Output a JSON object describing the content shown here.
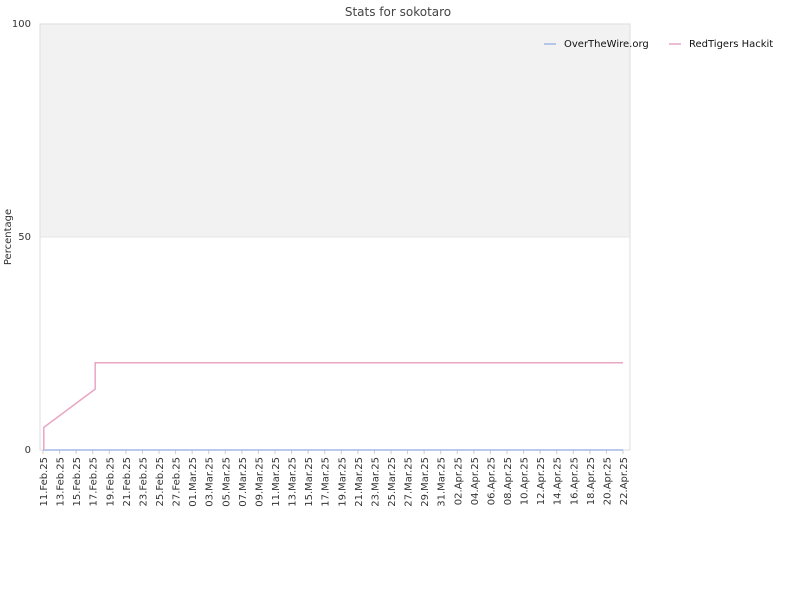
{
  "chart_data": {
    "type": "line",
    "title": "Stats for sokotaro",
    "xlabel": "",
    "ylabel": "Percentage",
    "ylim": [
      0,
      100
    ],
    "y_ticks": [
      "0",
      "50",
      "100"
    ],
    "x_ticks": [
      "11.Feb.25",
      "13.Feb.25",
      "15.Feb.25",
      "17.Feb.25",
      "19.Feb.25",
      "21.Feb.25",
      "23.Feb.25",
      "25.Feb.25",
      "27.Feb.25",
      "01.Mar.25",
      "03.Mar.25",
      "05.Mar.25",
      "07.Mar.25",
      "09.Mar.25",
      "11.Mar.25",
      "13.Mar.25",
      "15.Mar.25",
      "17.Mar.25",
      "19.Mar.25",
      "21.Mar.25",
      "23.Mar.25",
      "25.Mar.25",
      "27.Mar.25",
      "29.Mar.25",
      "31.Mar.25",
      "02.Apr.25",
      "04.Apr.25",
      "06.Apr.25",
      "08.Apr.25",
      "10.Apr.25",
      "12.Apr.25",
      "14.Apr.25",
      "16.Apr.25",
      "18.Apr.25",
      "20.Apr.25",
      "22.Apr.25"
    ],
    "grid": true,
    "legend_position": "top-right",
    "series": [
      {
        "name": "OverTheWire.org",
        "color": "#a3b8e8",
        "points": [
          [
            "11.Feb.25",
            0
          ],
          [
            "21.Apr.25",
            0
          ]
        ]
      },
      {
        "name": "RedTigers Hackit",
        "color": "#e8a6c3",
        "points": [
          [
            "11.Feb.25",
            0
          ],
          [
            "11.Feb.25",
            5.3
          ],
          [
            "17.Feb.25",
            14.3
          ],
          [
            "17.Feb.25",
            20.5
          ],
          [
            "21.Apr.25",
            20.5
          ]
        ]
      }
    ],
    "upper_band_color": "#f2f2f2"
  }
}
